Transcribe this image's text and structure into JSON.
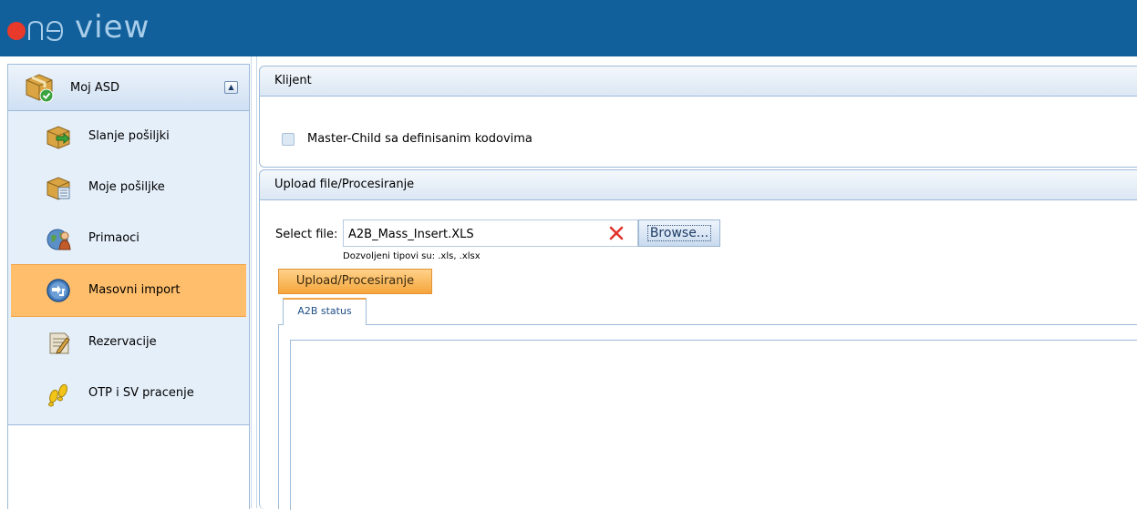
{
  "header": {
    "logo_text": "view",
    "bg_color": "#12609b"
  },
  "sidebar": {
    "section_title": "Moj ASD",
    "section_icon": "package-check-icon",
    "collapse_icon": "chevron-up-icon",
    "items": [
      {
        "label": "Slanje pošiljki",
        "icon": "package-send-icon",
        "active": false
      },
      {
        "label": "Moje pošiljke",
        "icon": "package-list-icon",
        "active": false
      },
      {
        "label": "Primaoci",
        "icon": "recipients-icon",
        "active": false
      },
      {
        "label": "Masovni import",
        "icon": "import-arrows-icon",
        "active": true
      },
      {
        "label": "Rezervacije",
        "icon": "reservation-icon",
        "active": false
      },
      {
        "label": "OTP i SV pracenje",
        "icon": "footprints-icon",
        "active": false
      }
    ],
    "active_color": "#ffbe6b"
  },
  "klijent_panel": {
    "title": "Klijent",
    "checkbox_label": "Master-Child sa definisanim kodovima",
    "checkbox_checked": false
  },
  "upload_panel": {
    "title": "Upload file/Procesiranje",
    "select_label": "Select file:",
    "file_value": "A2B_Mass_Insert.XLS",
    "browse_label": "Browse...",
    "allowed_types": "Dozvoljeni tipovi su: .xls, .xlsx",
    "upload_button": "Upload/Procesiranje",
    "tabs": [
      {
        "label": "A2B status",
        "active": true
      }
    ]
  }
}
